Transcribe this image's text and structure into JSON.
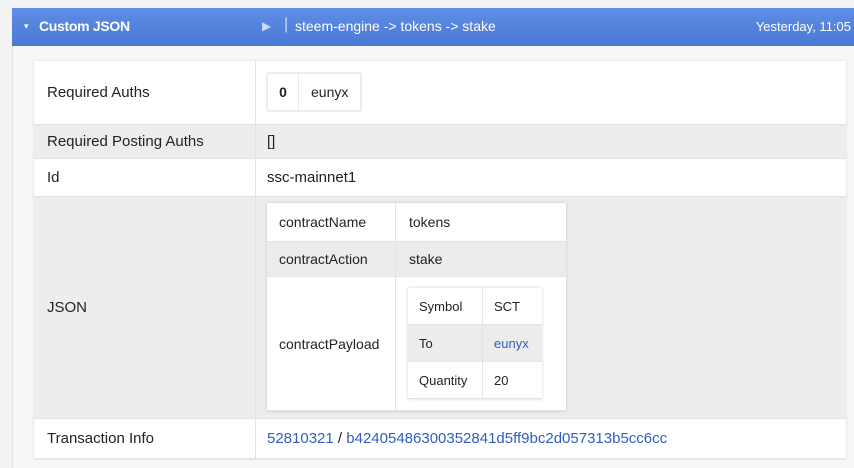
{
  "header": {
    "caret": "▾",
    "title": "Custom JSON",
    "play": "▶",
    "separator": "|",
    "operation": "steem-engine -> tokens -> stake",
    "timestamp": "Yesterday, 11:05"
  },
  "fields": {
    "required_auths": {
      "label": "Required Auths",
      "items": [
        {
          "index": "0",
          "value": "eunyx"
        }
      ]
    },
    "required_posting_auths": {
      "label": "Required Posting Auths",
      "value": "[]"
    },
    "id": {
      "label": "Id",
      "value": "ssc-mainnet1"
    },
    "json": {
      "label": "JSON",
      "contractName": {
        "key": "contractName",
        "value": "tokens"
      },
      "contractAction": {
        "key": "contractAction",
        "value": "stake"
      },
      "contractPayload": {
        "key": "contractPayload",
        "symbol": {
          "key": "Symbol",
          "value": "SCT"
        },
        "to": {
          "key": "To",
          "value": "eunyx"
        },
        "quantity": {
          "key": "Quantity",
          "value": "20"
        }
      }
    },
    "transaction_info": {
      "label": "Transaction Info",
      "block": "52810321",
      "slash": "/",
      "tx_id": "b42405486300352841d5ff9bc2d057313b5cc6cc"
    }
  },
  "colors": {
    "header_top": "#5f8ee6",
    "header_bottom": "#4a78d4",
    "link": "#2f5ec4"
  }
}
